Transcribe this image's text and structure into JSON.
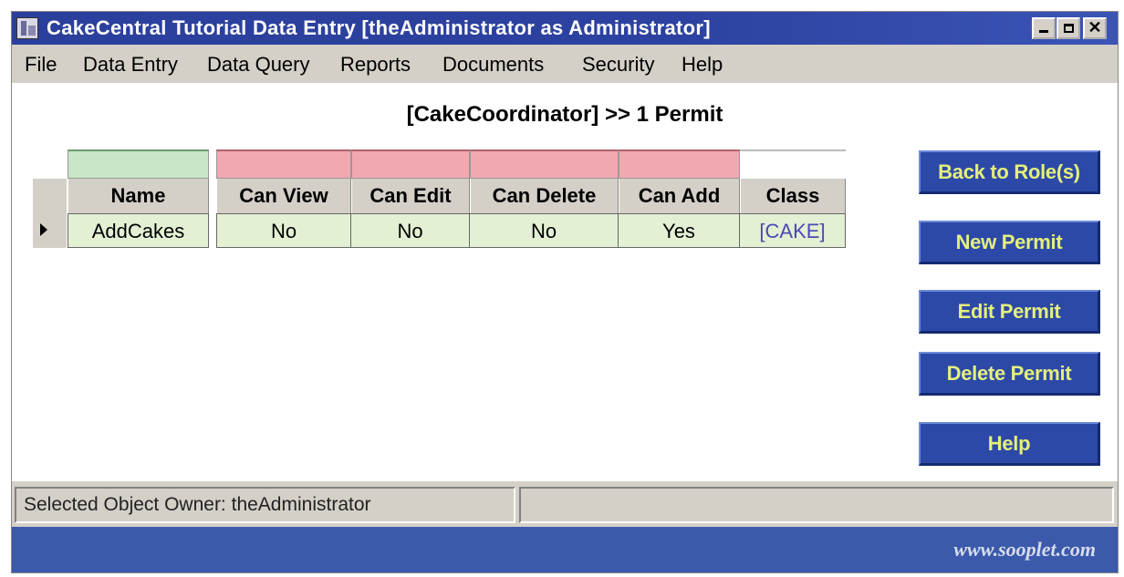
{
  "window": {
    "title": "CakeCentral Tutorial Data Entry [theAdministrator as Administrator]",
    "controls": [
      "minimize-icon",
      "maximize-icon",
      "close-icon"
    ]
  },
  "menu": {
    "file": "File",
    "data_entry": "Data Entry",
    "data_query": "Data Query",
    "reports": "Reports",
    "documents": "Documents",
    "security": "Security",
    "help": "Help"
  },
  "main": {
    "heading": "[CakeCoordinator] >> 1 Permit",
    "table": {
      "columns": [
        "Name",
        "Can View",
        "Can Edit",
        "Can Delete",
        "Can Add",
        "Class"
      ],
      "rows": [
        [
          "AddCakes",
          "No",
          "No",
          "No",
          "Yes",
          "[CAKE]"
        ]
      ]
    }
  },
  "buttons": {
    "back": "Back to Role(s)",
    "new": "New Permit",
    "edit": "Edit Permit",
    "delete": "Delete Permit",
    "help": "Help"
  },
  "status": {
    "left": "Selected Object Owner: theAdministrator",
    "right": ""
  },
  "footer": {
    "brand": "www.sooplet.com"
  },
  "colors": {
    "title_bar": "#2b3f9c",
    "button_bg": "#2d49a8",
    "button_text": "#e4f07c",
    "footer_bg": "#3b5aac",
    "filter_name": "#c8e6c8",
    "filter_other": "#f2a8b0",
    "row_bg": "#e4f0d4",
    "class_link": "#4a4ab0"
  }
}
